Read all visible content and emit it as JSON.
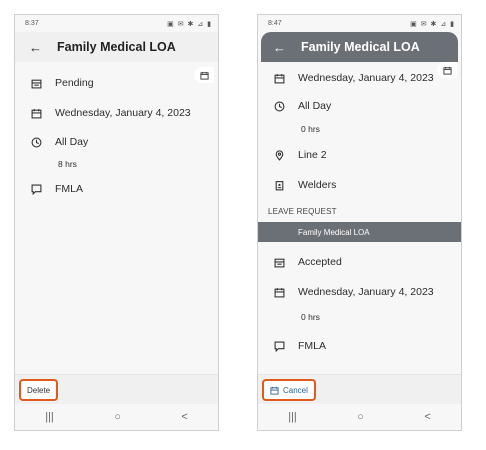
{
  "left": {
    "status": {
      "time": "8:37",
      "icons": "▣ ✉ ✱ ⊿ ▮"
    },
    "app_bar": {
      "back": "←",
      "title": "Family Medical LOA"
    },
    "rows": {
      "status_value": "Pending",
      "date": "Wednesday, January 4, 2023",
      "time": "All Day",
      "hours": "8 hrs",
      "reason": "FMLA"
    },
    "action_button": {
      "label": "Delete"
    },
    "nav": {
      "recents": "|||",
      "home": "○",
      "back": "<"
    }
  },
  "right": {
    "status": {
      "time": "8:47",
      "icons": "▣ ✉ ✱ ⊿ ▮"
    },
    "app_bar": {
      "back": "←",
      "title": "Family Medical LOA"
    },
    "rows": {
      "date": "Wednesday, January 4, 2023",
      "time": "All Day",
      "hours": "0 hrs",
      "location": "Line 2",
      "department": "Welders",
      "section_header": "LEAVE REQUEST",
      "leave_type": "Family Medical LOA",
      "status_value": "Accepted",
      "date2": "Wednesday, January 4, 2023",
      "hours2": "0 hrs",
      "reason": "FMLA"
    },
    "action_button": {
      "label": "Cancel"
    },
    "nav": {
      "recents": "|||",
      "home": "○",
      "back": "<"
    }
  },
  "colors": {
    "highlight": "#e05a1c",
    "app_bar_dark": "#6b6f76",
    "cancel_text": "#2f5f8f"
  }
}
